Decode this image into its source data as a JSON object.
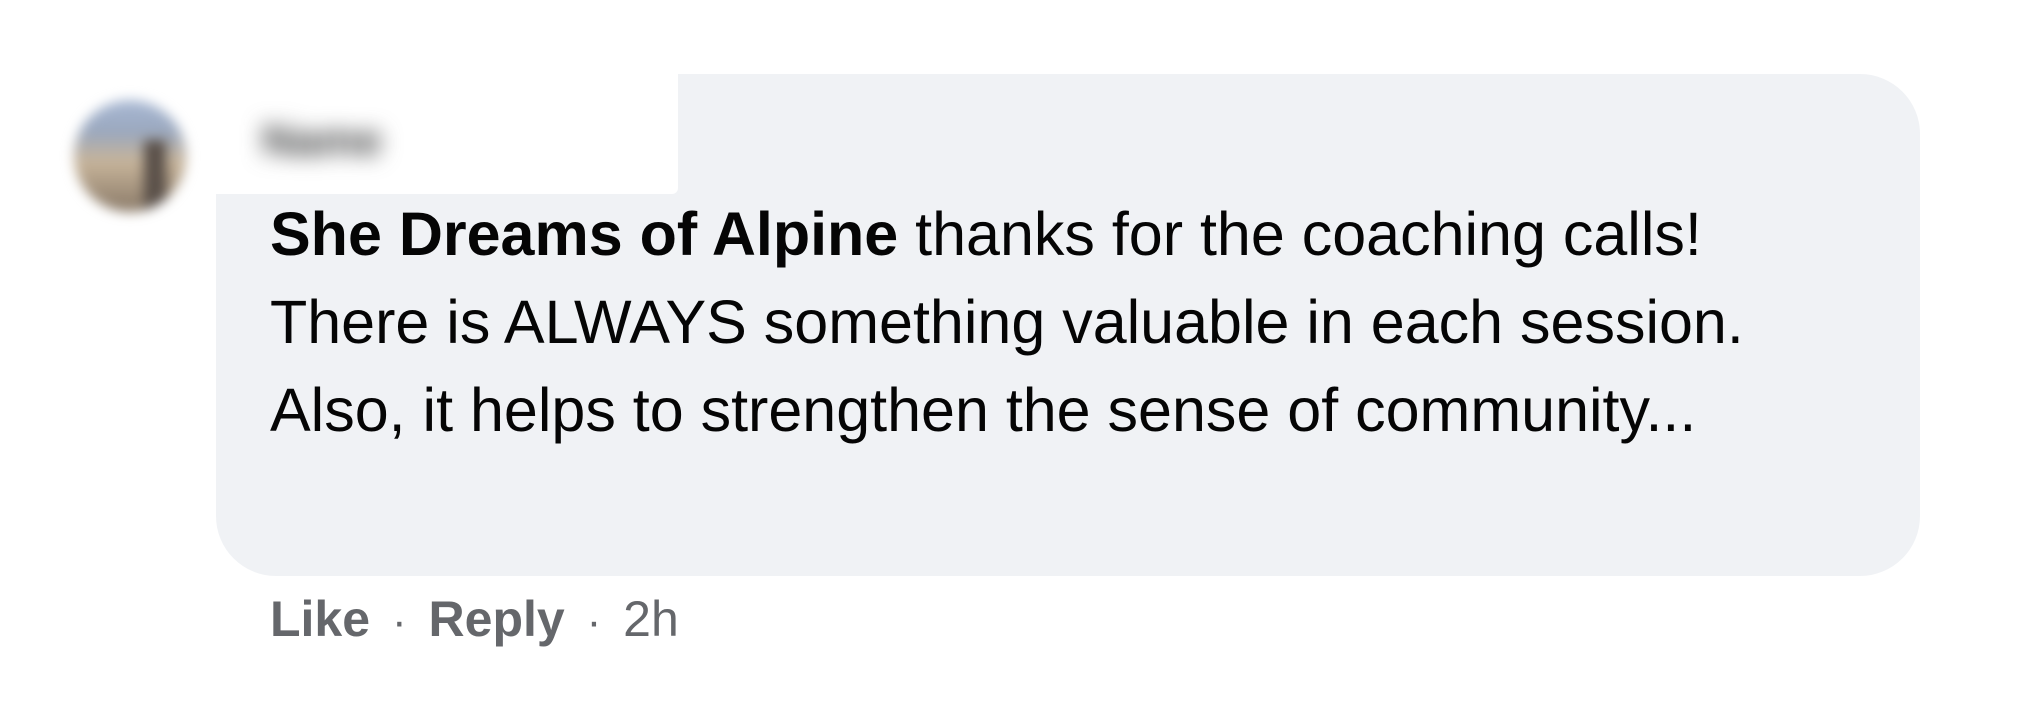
{
  "comment": {
    "author_name": "Name",
    "mention": "She Dreams of Alpine",
    "text": " thanks for the coaching calls! There is ALWAYS something valuable in each session. Also, it helps to strengthen the sense of community...",
    "actions": {
      "like_label": "Like",
      "separator": "·",
      "reply_label": "Reply",
      "timestamp": "2h"
    }
  },
  "colors": {
    "bubble_background": "#f0f2f5",
    "text": "#050505",
    "secondary_text": "#65676b"
  },
  "icons": {
    "avatar": "profile-photo-blurred"
  }
}
